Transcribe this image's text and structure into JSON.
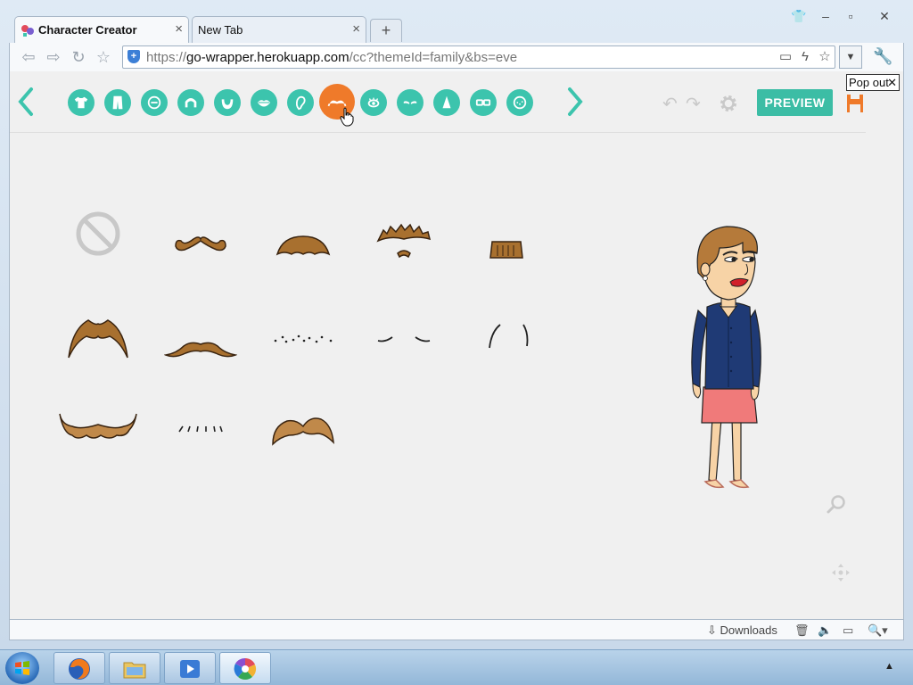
{
  "tabs": [
    {
      "title": "Character Creator",
      "active": true
    },
    {
      "title": "New Tab",
      "active": false
    }
  ],
  "address_bar": {
    "scheme": "https://",
    "host": "go-wrapper.herokuapp.com",
    "path": "/cc?themeId=family&bs=eve"
  },
  "creator": {
    "categories": [
      {
        "id": "shirt",
        "icon": "shirt-icon"
      },
      {
        "id": "pants",
        "icon": "pants-icon"
      },
      {
        "id": "face-shape",
        "icon": "face-shape-icon"
      },
      {
        "id": "hair",
        "icon": "hair-icon"
      },
      {
        "id": "beard",
        "icon": "beard-icon"
      },
      {
        "id": "lips",
        "icon": "lips-icon"
      },
      {
        "id": "ear",
        "icon": "ear-icon"
      },
      {
        "id": "mustache",
        "icon": "mustache-icon",
        "selected": true
      },
      {
        "id": "eyes",
        "icon": "eyes-icon"
      },
      {
        "id": "eyebrows",
        "icon": "eyebrows-icon"
      },
      {
        "id": "nose",
        "icon": "nose-icon"
      },
      {
        "id": "glasses",
        "icon": "glasses-icon"
      },
      {
        "id": "face-marks",
        "icon": "face-marks-icon"
      }
    ],
    "preview_label": "PREVIEW",
    "popout_label": "Pop out",
    "colors": {
      "teal": "#3cc4ad",
      "orange": "#ef7a2a",
      "hair_brown": "#a8702f",
      "shirt_navy": "#1f3a75",
      "skirt_pink": "#f07a7a"
    }
  },
  "statusbar": {
    "downloads_label": "Downloads"
  }
}
